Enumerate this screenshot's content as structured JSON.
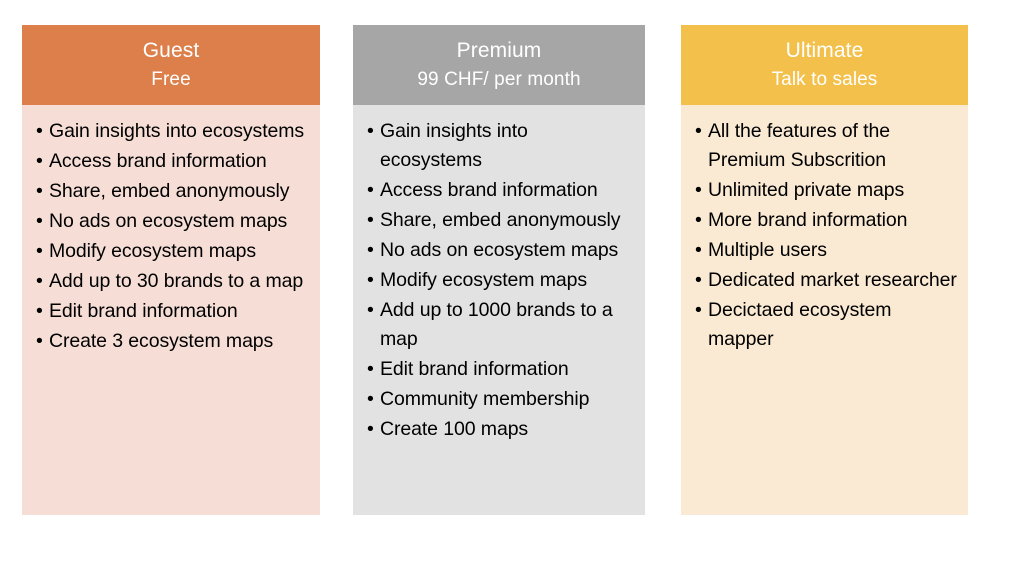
{
  "plans": [
    {
      "name": "Guest",
      "price": "Free",
      "header_color": "#dd7f4b",
      "body_color": "#f6ded7",
      "features": [
        "Gain insights into ecosystems",
        "Access brand information",
        "Share, embed anonymously",
        "No ads on ecosystem maps",
        "Modify ecosystem maps",
        "Add up to 30 brands to a map",
        "Edit brand information",
        "Create 3 ecosystem maps"
      ]
    },
    {
      "name": "Premium",
      "price": "99 CHF/ per month",
      "header_color": "#a6a6a6",
      "body_color": "#e2e2e2",
      "features": [
        "Gain insights into ecosystems",
        "Access brand information",
        "Share, embed anonymously",
        "No ads on ecosystem maps",
        "Modify ecosystem maps",
        "Add up to 1000 brands to a map",
        "Edit brand information",
        "Community membership",
        "Create 100 maps"
      ]
    },
    {
      "name": "Ultimate",
      "price": "Talk to sales",
      "header_color": "#f3c04b",
      "body_color": "#faead3",
      "features": [
        "All the features of the Premium Subscrition",
        "Unlimited private maps",
        "More brand information",
        "Multiple users",
        "Dedicated market researcher",
        "Decictaed ecosystem mapper"
      ]
    }
  ],
  "bullet_glyph": "•"
}
